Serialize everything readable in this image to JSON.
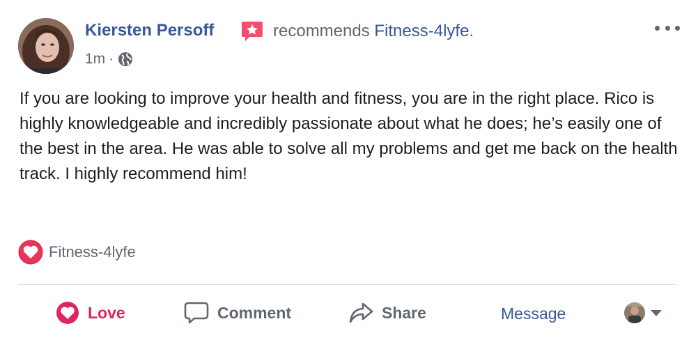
{
  "post": {
    "author": "Kiersten Persoff",
    "action_text": "recommends ",
    "page_name": "Fitness-4lyfe",
    "page_suffix": ".",
    "timestamp": "1m",
    "separator": "·",
    "privacy_icon": "globe-icon",
    "body": "If you are looking to improve your health and fitness, you are in the right place. Rico is highly knowledgeable and incredibly passionate about what he does; he’s easily one of the best in the area. He was able to solve all my problems and get me back on the health track. I highly recommend him!",
    "tag_label": "Fitness-4lyfe"
  },
  "actions": {
    "love_label": "Love",
    "comment_label": "Comment",
    "share_label": "Share",
    "message_label": "Message"
  },
  "colors": {
    "link_blue": "#385898",
    "love_red": "#e0245e",
    "muted_gray": "#606770",
    "badge_pink": "#f0506e"
  }
}
